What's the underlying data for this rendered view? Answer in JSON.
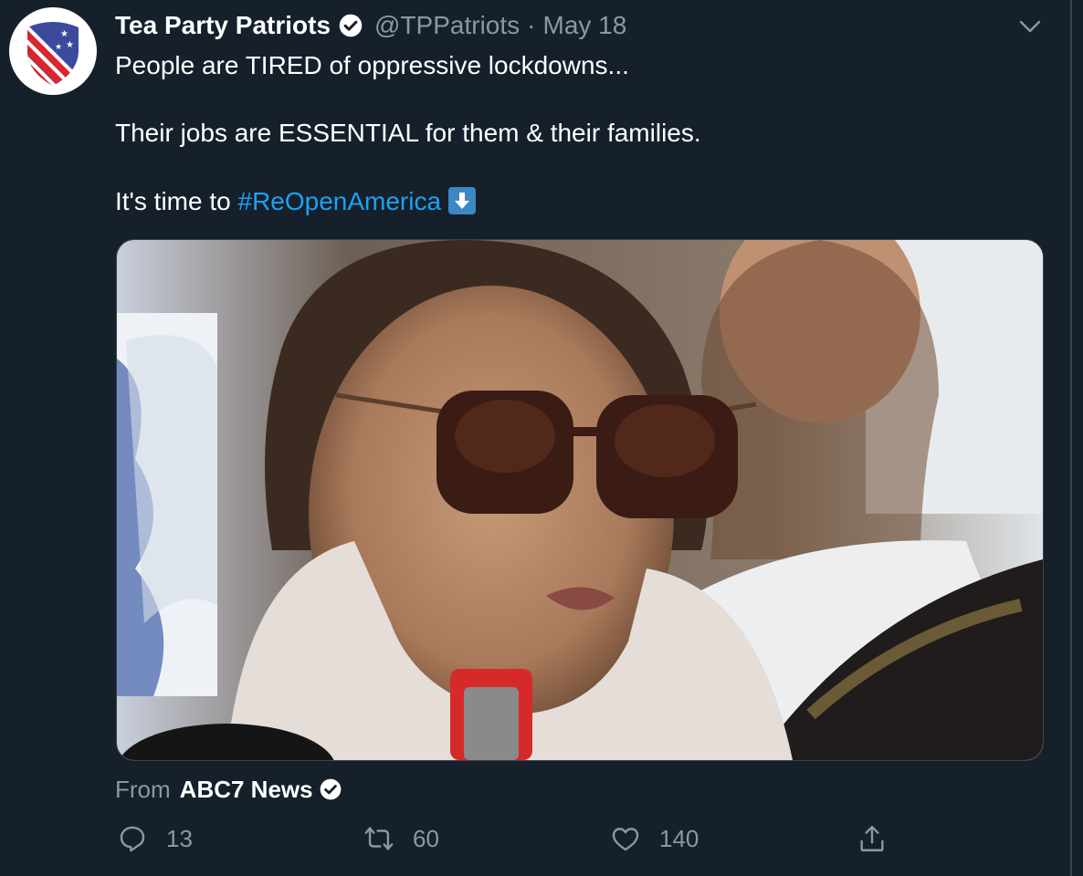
{
  "tweet": {
    "author_name": "Tea Party Patriots",
    "handle": "@TPPatriots",
    "separator": "·",
    "date": "May 18",
    "line1": "People are TIRED of oppressive lockdowns...",
    "line2": "Their jobs are ESSENTIAL for them & their families.",
    "line3_prefix": "It's time to ",
    "hashtag": "#ReOpenAmerica",
    "emoji": "down-arrow-emoji"
  },
  "media": {
    "source_label": "From",
    "source_name": "ABC7 News"
  },
  "actions": {
    "reply_count": "13",
    "retweet_count": "60",
    "like_count": "140"
  },
  "colors": {
    "background": "#15202b",
    "text": "#ffffff",
    "secondary": "#8899a6",
    "link": "#1da1f2",
    "border": "#38444d"
  },
  "icons": [
    "avatar-logo-icon",
    "verified-icon",
    "chevron-down-icon",
    "reply-icon",
    "retweet-icon",
    "like-icon",
    "share-icon"
  ]
}
